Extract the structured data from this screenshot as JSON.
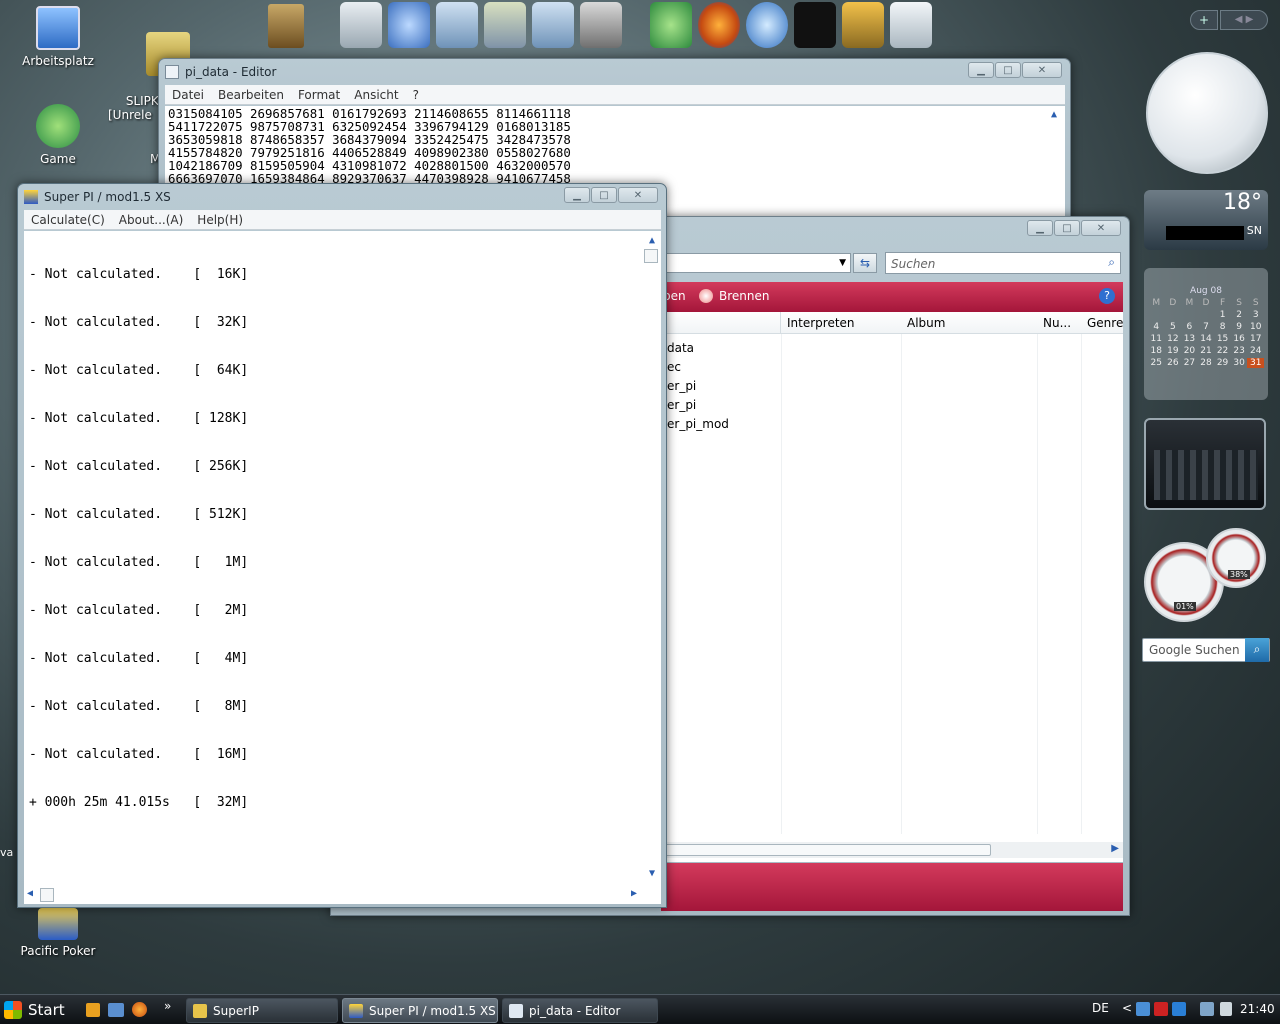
{
  "desktop": {
    "icons": [
      {
        "label": "Arbeitsplatz",
        "color": "#3a7bd5"
      },
      {
        "label": "SLIPKN\n[Unrele",
        "color": "#c9b24a"
      },
      {
        "label": "Game",
        "color": "#2f9c58"
      },
      {
        "label": "M",
        "color": "#777"
      },
      {
        "label": "Pacific Poker",
        "color": "#2b5cc7"
      }
    ],
    "left_edge_text": "va"
  },
  "dock": {
    "items": [
      "monitor-icon",
      "network-icon",
      "folder-icon",
      "folder-icon",
      "folder-icon",
      "tools-icon",
      "trophy-icon",
      "firefox-icon",
      "globe-icon",
      "tshirt-icon",
      "hammer-icon",
      "recycle-bin-icon"
    ]
  },
  "notepad": {
    "title": "pi_data - Editor",
    "menu": [
      "Datei",
      "Bearbeiten",
      "Format",
      "Ansicht",
      "?"
    ],
    "lines": [
      "0315084105 2696857681 0161792693 2114608655 8114661118",
      "5411722075 9875708731 6325092454 3396794129 0168013185",
      "3653059818 8748658357 3684379094 3352425475 3428473578",
      "4155784820 7979251816 4406528849 4098902380 0558027680",
      "1042186709 8159505904 4310981072 4028801500 4632000570",
      "6663697070 1659384864 8929370637 4470398928 9410677458"
    ]
  },
  "explorer": {
    "search_placeholder": "Suchen",
    "toolbar_partial": "ben",
    "burn_label": "Brennen",
    "columns": [
      "Interpreten",
      "Album",
      "Nu...",
      "Genre"
    ],
    "files": [
      "data",
      "ec",
      "er_pi",
      "er_pi",
      "er_pi_mod"
    ]
  },
  "superpi": {
    "title": "Super PI / mod1.5 XS",
    "menu": [
      "Calculate(C)",
      "About...(A)",
      "Help(H)"
    ],
    "results": [
      "- Not calculated.    [  16K]",
      "- Not calculated.    [  32K]",
      "- Not calculated.    [  64K]",
      "- Not calculated.    [ 128K]",
      "- Not calculated.    [ 256K]",
      "- Not calculated.    [ 512K]",
      "- Not calculated.    [   1M]",
      "- Not calculated.    [   2M]",
      "- Not calculated.    [   4M]",
      "- Not calculated.    [   8M]",
      "- Not calculated.    [  16M]",
      "+ 000h 25m 41.015s   [  32M]"
    ]
  },
  "sidebar": {
    "weather_temp": "18°",
    "weather_loc": "SN",
    "calendar_month": "Aug 08",
    "calendar_days": [
      "M",
      "D",
      "M",
      "D",
      "F",
      "S",
      "S"
    ],
    "calendar_dates": [
      [
        "",
        "",
        "",
        "",
        "1",
        "2",
        "3"
      ],
      [
        "4",
        "5",
        "6",
        "7",
        "8",
        "9",
        "10"
      ],
      [
        "11",
        "12",
        "13",
        "14",
        "15",
        "16",
        "17"
      ],
      [
        "18",
        "19",
        "20",
        "21",
        "22",
        "23",
        "24"
      ],
      [
        "25",
        "26",
        "27",
        "28",
        "29",
        "30",
        "31"
      ]
    ],
    "cpu_pct": "01%",
    "mem_pct": "38%",
    "google_placeholder": "Google Suchen"
  },
  "taskbar": {
    "start": "Start",
    "chevron": "»",
    "buttons": [
      {
        "label": "SuperIP"
      },
      {
        "label": "Super PI / mod1.5 XS"
      },
      {
        "label": "pi_data - Editor"
      }
    ],
    "lang": "DE",
    "tray_chevron": "<",
    "time": "21:40"
  }
}
